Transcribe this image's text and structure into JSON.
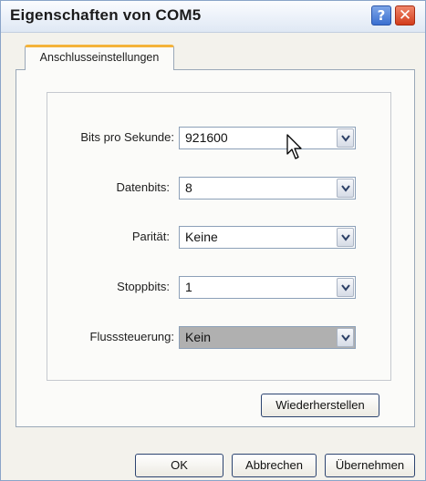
{
  "window": {
    "title": "Eigenschaften von COM5"
  },
  "titlebar_buttons": {
    "help": "?",
    "close": "✕"
  },
  "tab": {
    "label": "Anschlusseinstellungen"
  },
  "fields": [
    {
      "label": "Bits pro Sekunde:",
      "value": "921600"
    },
    {
      "label": "Datenbits:",
      "value": "8"
    },
    {
      "label": "Parität:",
      "value": "Keine"
    },
    {
      "label": "Stoppbits:",
      "value": "1"
    },
    {
      "label": "Flusssteuerung:",
      "value": "Kein"
    }
  ],
  "buttons": {
    "restore": "Wiederherstellen",
    "ok": "OK",
    "cancel": "Abbrechen",
    "apply": "Übernehmen"
  },
  "colors": {
    "tab_accent": "#f4b33a",
    "selected_field": "#b0b0b0"
  }
}
